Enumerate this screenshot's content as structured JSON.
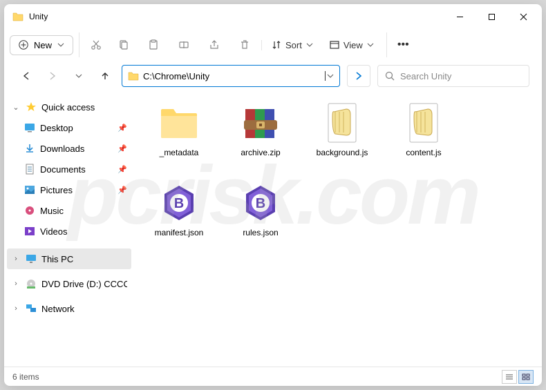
{
  "window": {
    "title": "Unity"
  },
  "toolbar": {
    "new_label": "New",
    "sort_label": "Sort",
    "view_label": "View"
  },
  "address": {
    "path": "C:\\Chrome\\Unity"
  },
  "search": {
    "placeholder": "Search Unity"
  },
  "sidebar": {
    "quick_access": "Quick access",
    "items": [
      {
        "label": "Desktop",
        "pinned": true
      },
      {
        "label": "Downloads",
        "pinned": true
      },
      {
        "label": "Documents",
        "pinned": true
      },
      {
        "label": "Pictures",
        "pinned": true
      },
      {
        "label": "Music",
        "pinned": false
      },
      {
        "label": "Videos",
        "pinned": false
      }
    ],
    "this_pc": "This PC",
    "dvd": "DVD Drive (D:) CCCC",
    "network": "Network"
  },
  "files": [
    {
      "name": "_metadata",
      "type": "folder"
    },
    {
      "name": "archive.zip",
      "type": "zip"
    },
    {
      "name": "background.js",
      "type": "js"
    },
    {
      "name": "content.js",
      "type": "js"
    },
    {
      "name": "manifest.json",
      "type": "json"
    },
    {
      "name": "rules.json",
      "type": "json"
    }
  ],
  "status": {
    "count": "6 items"
  },
  "watermark": "pcrisk.com"
}
